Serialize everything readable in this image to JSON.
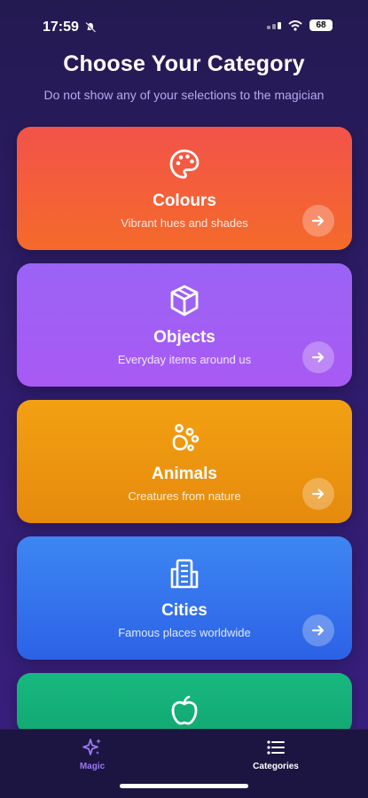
{
  "status": {
    "time": "17:59",
    "battery": "68"
  },
  "header": {
    "title": "Choose Your Category",
    "subtitle": "Do not show any of your selections to the magician"
  },
  "categories": [
    {
      "name": "Colours",
      "description": "Vibrant hues and shades",
      "icon": "palette-icon",
      "color": "#f2584a"
    },
    {
      "name": "Objects",
      "description": "Everyday items around us",
      "icon": "box-icon",
      "color": "#a35ef4"
    },
    {
      "name": "Animals",
      "description": "Creatures from nature",
      "icon": "paw-icon",
      "color": "#ef970f"
    },
    {
      "name": "Cities",
      "description": "Famous places worldwide",
      "icon": "building-icon",
      "color": "#3577ee"
    },
    {
      "name": "",
      "description": "",
      "icon": "apple-icon",
      "color": "#15b27a"
    }
  ],
  "tabs": [
    {
      "label": "Magic",
      "icon": "sparkles-icon",
      "active": false
    },
    {
      "label": "Categories",
      "icon": "list-icon",
      "active": true
    }
  ]
}
